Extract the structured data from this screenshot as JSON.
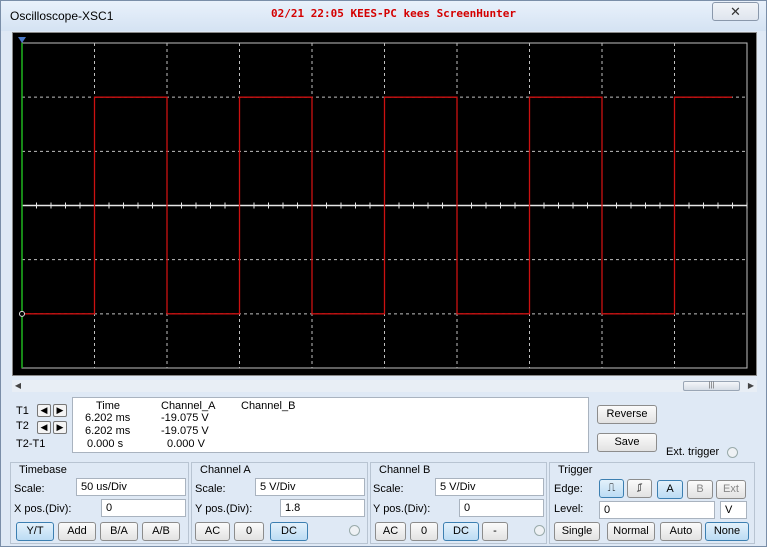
{
  "window": {
    "title": "Oscilloscope-XSC1",
    "close_glyph": "✕"
  },
  "watermark": "02/21 22:05 KEES-PC kees ScreenHunter",
  "colors": {
    "trace_a": "#cc1111",
    "grid": "#bfbfbf",
    "screen_bg": "#000000",
    "cursor_line": "#1fb51f"
  },
  "scope": {
    "grid_cols": 10,
    "grid_rows": 6,
    "channel_a_waveform": {
      "type": "square",
      "period_divs": 2.0,
      "low_div": -2,
      "high_div": 2,
      "first_rise_div": 1.0
    }
  },
  "cursors": {
    "t1_label": "T1",
    "t2_label": "T2",
    "diff_label": "T2-T1",
    "columns": [
      "Time",
      "Channel_A",
      "Channel_B"
    ],
    "rows": [
      {
        "time": "6.202 ms",
        "channel_a": "-19.075 V",
        "channel_b": ""
      },
      {
        "time": "6.202 ms",
        "channel_a": "-19.075 V",
        "channel_b": ""
      },
      {
        "time": "0.000 s",
        "channel_a": "0.000 V",
        "channel_b": ""
      }
    ]
  },
  "side": {
    "reverse": "Reverse",
    "save": "Save",
    "ext_trigger": "Ext. trigger"
  },
  "timebase": {
    "title": "Timebase",
    "scale_label": "Scale:",
    "scale_value": "50 us/Div",
    "xpos_label": "X pos.(Div):",
    "xpos_value": "0",
    "buttons": [
      "Y/T",
      "Add",
      "B/A",
      "A/B"
    ]
  },
  "channel_a": {
    "title": "Channel A",
    "scale_label": "Scale:",
    "scale_value": "5  V/Div",
    "ypos_label": "Y pos.(Div):",
    "ypos_value": "1.8",
    "buttons": [
      "AC",
      "0",
      "DC"
    ]
  },
  "channel_b": {
    "title": "Channel B",
    "scale_label": "Scale:",
    "scale_value": "5  V/Div",
    "ypos_label": "Y pos.(Div):",
    "ypos_value": "0",
    "buttons": [
      "AC",
      "0",
      "DC",
      "-"
    ]
  },
  "trigger": {
    "title": "Trigger",
    "edge_label": "Edge:",
    "edge_buttons": [
      "A",
      "B",
      "Ext"
    ],
    "level_label": "Level:",
    "level_value": "0",
    "level_unit": "V",
    "mode_buttons": [
      "Single",
      "Normal",
      "Auto",
      "None"
    ]
  }
}
